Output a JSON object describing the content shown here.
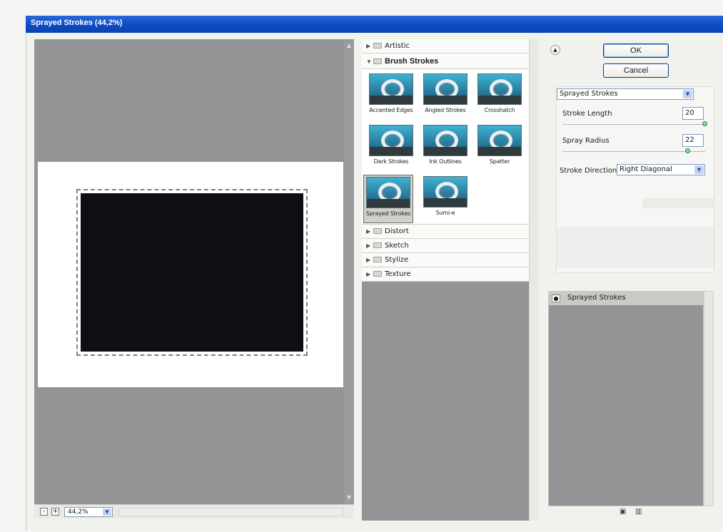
{
  "window": {
    "title": "Sprayed Strokes (44,2%)"
  },
  "preview": {
    "zoom": "44,2%",
    "zoom_out": "-",
    "zoom_in": "+"
  },
  "gallery": {
    "categories_before": [
      {
        "label": "Artistic",
        "expanded": false
      }
    ],
    "open_category": {
      "label": "Brush Strokes",
      "expanded": true
    },
    "filters": [
      {
        "label": "Accented Edges"
      },
      {
        "label": "Angled Strokes"
      },
      {
        "label": "Crosshatch"
      },
      {
        "label": "Dark Strokes"
      },
      {
        "label": "Ink Outlines"
      },
      {
        "label": "Spatter"
      },
      {
        "label": "Sprayed Strokes",
        "selected": true
      },
      {
        "label": "Sumi-e"
      }
    ],
    "categories_after": [
      {
        "label": "Distort"
      },
      {
        "label": "Sketch"
      },
      {
        "label": "Stylize"
      },
      {
        "label": "Texture"
      }
    ]
  },
  "buttons": {
    "ok": "OK",
    "cancel": "Cancel"
  },
  "settings": {
    "filter_select": "Sprayed Strokes",
    "stroke_length": {
      "label": "Stroke Length",
      "value": "20",
      "fraction": 1.0
    },
    "spray_radius": {
      "label": "Spray Radius",
      "value": "22",
      "fraction": 0.88
    },
    "stroke_direction": {
      "label": "Stroke Direction:",
      "value": "Right Diagonal"
    }
  },
  "layers": {
    "items": [
      {
        "label": "Sprayed Strokes",
        "visible": true
      }
    ]
  },
  "icons": {
    "collapse": "double-chevron-up-icon",
    "eye": "eye-icon",
    "new_layer": "new-effect-layer-icon",
    "delete": "trash-icon"
  },
  "colors": {
    "titlebar": "#0b4bc4",
    "preview_bg": "#939496",
    "slider_thumb": "#8fd89a"
  }
}
